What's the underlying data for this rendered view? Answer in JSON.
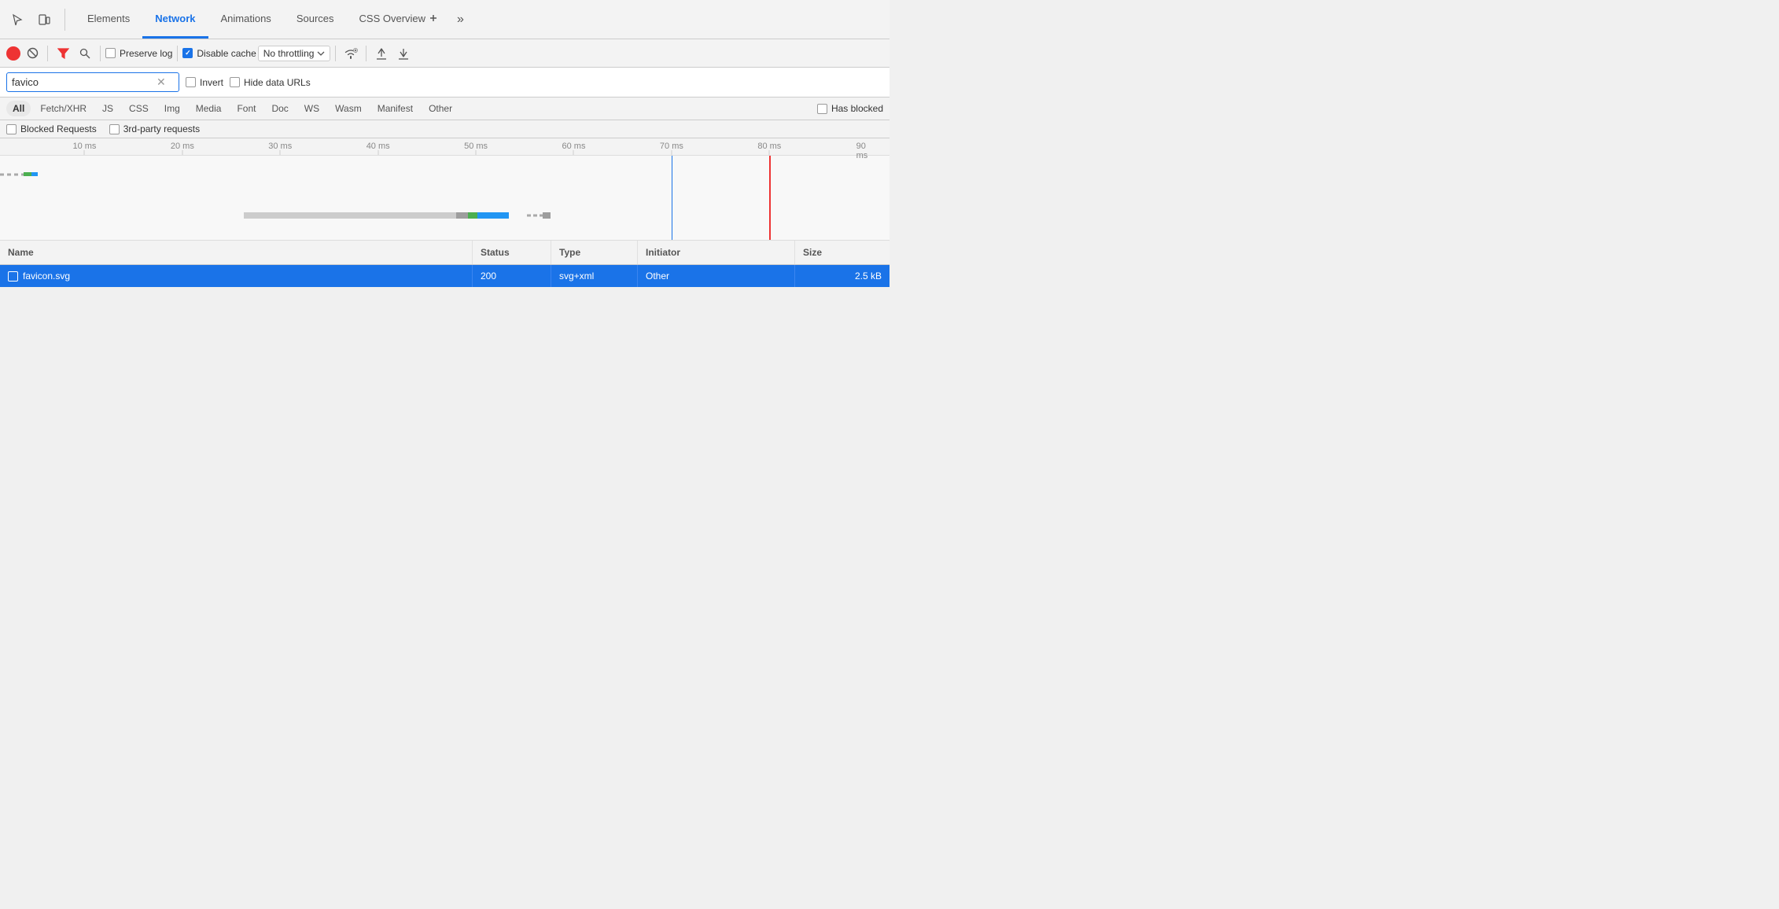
{
  "tabs": {
    "items": [
      {
        "label": "Elements",
        "active": false
      },
      {
        "label": "Network",
        "active": true
      },
      {
        "label": "Animations",
        "active": false
      },
      {
        "label": "Sources",
        "active": false
      },
      {
        "label": "CSS Overview",
        "active": false
      }
    ],
    "more_label": "»"
  },
  "toolbar": {
    "record_title": "Record",
    "clear_title": "Clear",
    "filter_title": "Filter",
    "search_title": "Search",
    "preserve_log_label": "Preserve log",
    "preserve_log_checked": false,
    "disable_cache_label": "Disable cache",
    "disable_cache_checked": true,
    "no_throttling_label": "No throttling",
    "upload_title": "Upload",
    "download_title": "Download"
  },
  "filter": {
    "search_value": "favico",
    "search_placeholder": "Filter",
    "invert_label": "Invert",
    "invert_checked": false,
    "hide_data_urls_label": "Hide data URLs",
    "hide_data_urls_checked": false
  },
  "type_filters": {
    "items": [
      {
        "label": "All",
        "active": true
      },
      {
        "label": "Fetch/XHR",
        "active": false
      },
      {
        "label": "JS",
        "active": false
      },
      {
        "label": "CSS",
        "active": false
      },
      {
        "label": "Img",
        "active": false
      },
      {
        "label": "Media",
        "active": false
      },
      {
        "label": "Font",
        "active": false
      },
      {
        "label": "Doc",
        "active": false
      },
      {
        "label": "WS",
        "active": false
      },
      {
        "label": "Wasm",
        "active": false
      },
      {
        "label": "Manifest",
        "active": false
      },
      {
        "label": "Other",
        "active": false
      }
    ],
    "has_blocked_label": "Has blocked"
  },
  "blocked_bar": {
    "blocked_requests_label": "Blocked Requests",
    "third_party_label": "3rd-party requests"
  },
  "timeline": {
    "ruler_marks": [
      {
        "label": "10 ms",
        "left_pct": 9.5
      },
      {
        "label": "20 ms",
        "left_pct": 20.5
      },
      {
        "label": "30 ms",
        "left_pct": 31.5
      },
      {
        "label": "40 ms",
        "left_pct": 42.5
      },
      {
        "label": "50 ms",
        "left_pct": 53.5
      },
      {
        "label": "60 ms",
        "left_pct": 64.5
      },
      {
        "label": "70 ms",
        "left_pct": 75.5
      },
      {
        "label": "80 ms",
        "left_pct": 86.5
      },
      {
        "label": "90 ms",
        "left_pct": 97.5
      }
    ]
  },
  "table": {
    "headers": [
      {
        "label": "Name"
      },
      {
        "label": "Status"
      },
      {
        "label": "Type"
      },
      {
        "label": "Initiator"
      },
      {
        "label": "Size"
      }
    ],
    "rows": [
      {
        "name": "favicon.svg",
        "status": "200",
        "type": "svg+xml",
        "initiator": "Other",
        "size": "2.5 kB",
        "selected": true
      }
    ]
  }
}
